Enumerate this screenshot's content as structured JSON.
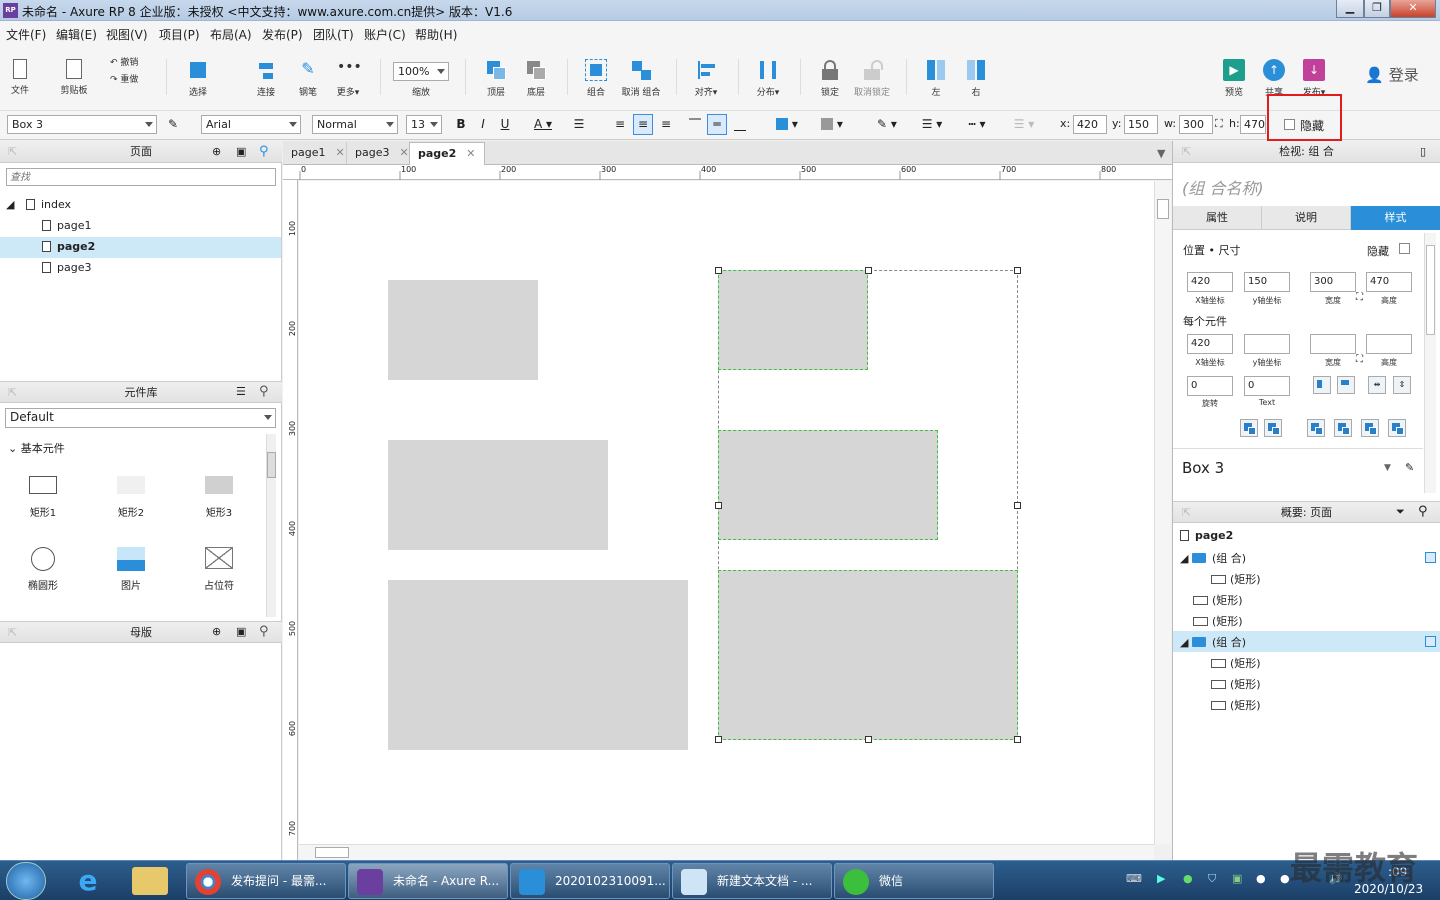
{
  "window": {
    "title": "未命名 - Axure RP 8 企业版：未授权      <中文支持：www.axure.com.cn提供> 版本：V1.6",
    "logo_text": "RP",
    "minimize": "▁",
    "maximize": "❐",
    "close": "✕"
  },
  "menu": [
    "文件(F)",
    "编辑(E)",
    "视图(V)",
    "项目(P)",
    "布局(A)",
    "发布(P)",
    "团队(T)",
    "账户(C)",
    "帮助(H)"
  ],
  "toolbar": {
    "file": "文件",
    "clipboard": "剪贴板",
    "undo": "撤销",
    "redo": "重做",
    "select": "选择",
    "connect": "连接",
    "pen": "钢笔",
    "more": "更多▾",
    "zoom_value": "100%",
    "zoom": "缩放",
    "top": "顶层",
    "bottom": "底层",
    "group": "组合",
    "ungroup": "取消 组合",
    "align": "对齐▾",
    "distribute": "分布▾",
    "lock": "锁定",
    "unlock": "取消锁定",
    "left": "左",
    "right": "右",
    "preview": "预览",
    "share": "共享",
    "publish": "发布▾",
    "login": "登录"
  },
  "format": {
    "widget_name": "Box 3",
    "font": "Arial",
    "style": "Normal",
    "size": "13",
    "bold": "B",
    "italic": "I",
    "underline": "U",
    "font_color": "A",
    "x_label": "x:",
    "x": "420",
    "y_label": "y:",
    "y": "150",
    "w_label": "w:",
    "w": "300",
    "h_label": "h:",
    "h": "470",
    "hidden_label": "隐藏"
  },
  "pages_panel": {
    "title": "页面",
    "search_placeholder": "查找",
    "items": [
      "index",
      "page1",
      "page2",
      "page3"
    ],
    "selected": "page2"
  },
  "library_panel": {
    "title": "元件库",
    "library": "Default",
    "section": "基本元件",
    "widgets": [
      "矩形1",
      "矩形2",
      "矩形3",
      "椭圆形",
      "图片",
      "占位符"
    ]
  },
  "masters_panel": {
    "title": "母版"
  },
  "tabs": [
    "page1",
    "page3",
    "page2"
  ],
  "active_tab": "page2",
  "ruler": {
    "h": [
      "0",
      "100",
      "200",
      "300",
      "400",
      "500",
      "600",
      "700",
      "800"
    ],
    "v": [
      "100",
      "200",
      "300",
      "400",
      "500",
      "600",
      "700"
    ]
  },
  "inspector": {
    "title": "检视: 组 合",
    "name_placeholder": "(组 合名称)",
    "tabs": [
      "属性",
      "说明",
      "样式"
    ],
    "active_tab": "样式",
    "pos_size": "位置 • 尺寸",
    "hidden": "隐藏",
    "x": "420",
    "y": "150",
    "w": "300",
    "h": "470",
    "x_label": "X轴坐标",
    "y_label": "y轴坐标",
    "w_label": "宽度",
    "h_label": "高度",
    "each": "每个元件",
    "each_x": "420",
    "rotate": "0",
    "rotate_label": "旋转",
    "text_rotate": "0",
    "text_label": "Text",
    "widget_name": "Box 3"
  },
  "outline": {
    "title": "概要: 页面",
    "page": "page2",
    "items": [
      "(组 合)",
      "(矩形)",
      "(矩形)",
      "(矩形)",
      "(组 合)",
      "(矩形)",
      "(矩形)",
      "(矩形)"
    ]
  },
  "taskbar": {
    "tasks": [
      "发布提问 - 最需...",
      "未命名 - Axure R...",
      "2020102310091...",
      "新建文本文档 - ...",
      "微信"
    ],
    "time": ":09",
    "date": "2020/10/23",
    "watermark": "最需教育"
  },
  "colors": {
    "accent": "#2a8fd8",
    "selection": "#3fbf3f",
    "highlight": "#e21c1c"
  }
}
